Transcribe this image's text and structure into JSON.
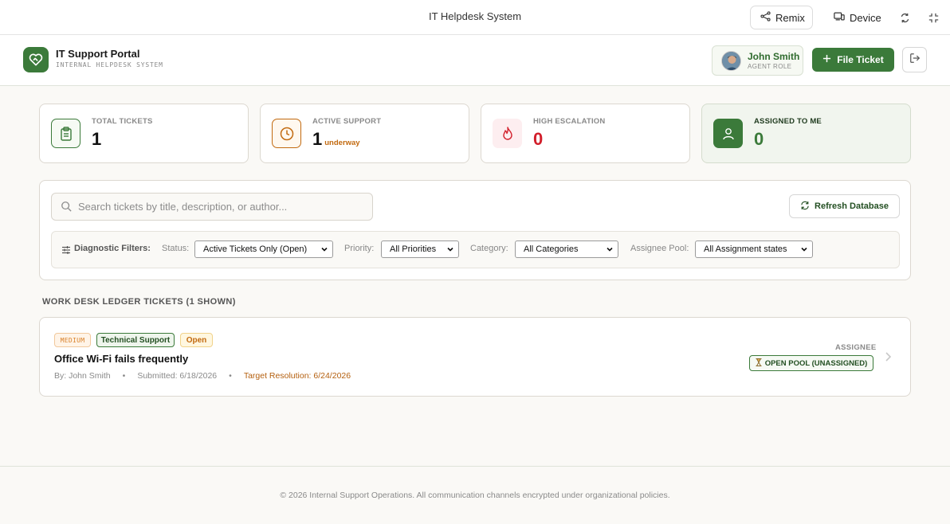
{
  "chrome": {
    "title": "IT Helpdesk System",
    "remix_label": "Remix",
    "device_label": "Device"
  },
  "header": {
    "brand_title": "IT Support Portal",
    "brand_subtitle": "INTERNAL HELPDESK SYSTEM",
    "user_name": "John Smith",
    "user_role": "AGENT ROLE",
    "file_ticket_label": "File Ticket"
  },
  "stats": [
    {
      "label": "TOTAL TICKETS",
      "value": "1",
      "suffix": ""
    },
    {
      "label": "ACTIVE SUPPORT",
      "value": "1",
      "suffix": "underway"
    },
    {
      "label": "HIGH ESCALATION",
      "value": "0",
      "suffix": ""
    },
    {
      "label": "ASSIGNED TO ME",
      "value": "0",
      "suffix": ""
    }
  ],
  "filters": {
    "search_placeholder": "Search tickets by title, description, or author...",
    "refresh_label": "Refresh Database",
    "title": "Diagnostic Filters:",
    "status_label": "Status:",
    "status_value": "Active Tickets Only (Open)",
    "priority_label": "Priority:",
    "priority_value": "All Priorities",
    "category_label": "Category:",
    "category_value": "All Categories",
    "assignee_label": "Assignee Pool:",
    "assignee_value": "All Assignment states"
  },
  "list": {
    "section_title": "WORK DESK LEDGER TICKETS (1 SHOWN)",
    "tickets": [
      {
        "priority": "MEDIUM",
        "category": "Technical Support",
        "status": "Open",
        "title": "Office Wi-Fi fails frequently",
        "author": "By: John Smith",
        "submitted": "Submitted: 6/18/2026",
        "target": "Target Resolution: 6/24/2026",
        "assignee_label": "ASSIGNEE",
        "assignee_value": "OPEN POOL (UNASSIGNED)"
      }
    ]
  },
  "footer": {
    "text": "© 2026 Internal Support Operations. All communication channels encrypted under organizational policies."
  },
  "colors": {
    "brand_green": "#3b7a3a",
    "active_orange": "#c26a10",
    "escalation_red": "#d21f2b",
    "assigned_green": "#3b7a3a"
  },
  "icons": {
    "remix": "share-nodes-icon",
    "device": "device-icon",
    "rotate": "rotate-icon",
    "fullscreen": "fullscreen-icon",
    "logo": "heart-handshake-icon",
    "file_ticket": "plus-icon",
    "logout": "logout-icon",
    "total": "clipboard-icon",
    "active": "clock-icon",
    "escalation": "flame-icon",
    "assigned": "user-icon",
    "search": "search-icon",
    "refresh": "refresh-icon",
    "filters": "sliders-icon",
    "assignee": "hourglass-icon",
    "row": "chevron-right-icon"
  }
}
